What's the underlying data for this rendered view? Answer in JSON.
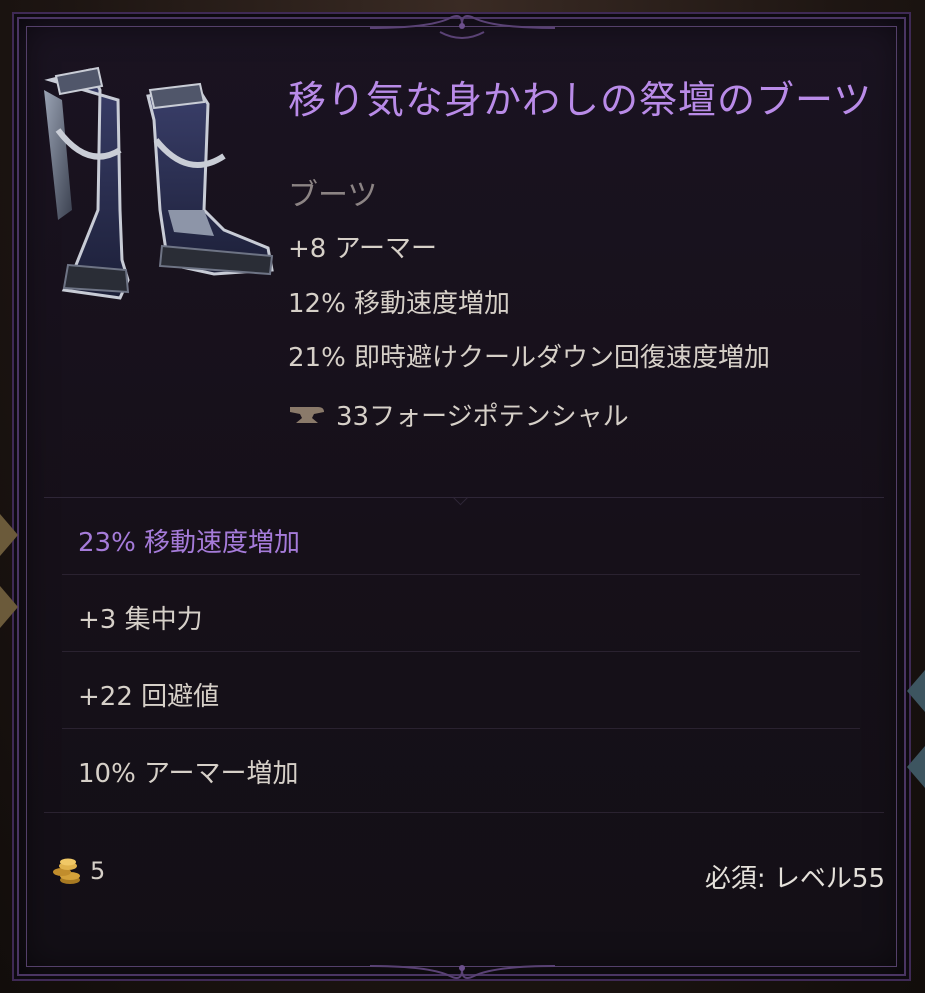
{
  "item": {
    "name": "移り気な身かわしの祭壇のブーツ",
    "type": "ブーツ",
    "base_stats": [
      "+8 アーマー",
      "12% 移動速度増加",
      "21% 即時避けクールダウン回復速度増加"
    ],
    "forge_potential": "33フォージポテンシャル",
    "affixes": [
      {
        "text": "23% 移動速度増加",
        "color": "#a57bd9"
      },
      {
        "text": "+3 集中力",
        "color": "#d6d0c8"
      },
      {
        "text": "+22 回避値",
        "color": "#d6d0c8"
      },
      {
        "text": "10% アーマー増加",
        "color": "#d6d0c8"
      }
    ],
    "gold_value": "5",
    "requirement_label": "必須:",
    "requirement_value": "レベル55"
  },
  "colors": {
    "title": "#b98be8",
    "subtype": "#8c8484",
    "stat_text": "#d6d0c8",
    "frame_purple": "#4a3563"
  },
  "icons": [
    "forge-anvil-icon",
    "gold-coins-icon"
  ]
}
